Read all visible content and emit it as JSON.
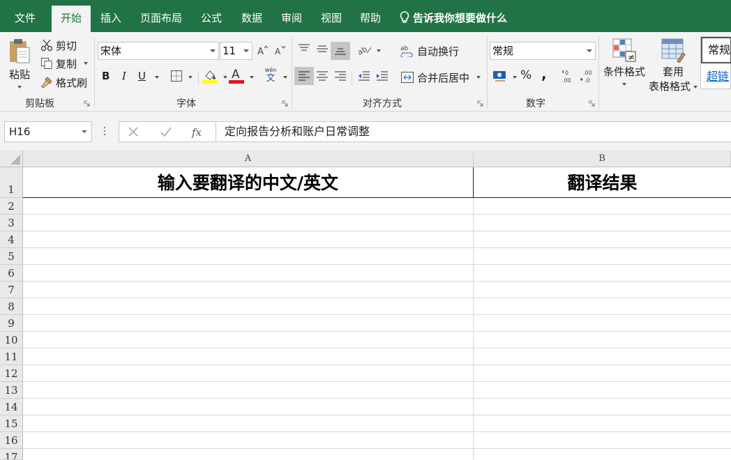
{
  "tabs": [
    {
      "label": "文件",
      "active": false
    },
    {
      "label": "开始",
      "active": true
    },
    {
      "label": "插入",
      "active": false
    },
    {
      "label": "页面布局",
      "active": false
    },
    {
      "label": "公式",
      "active": false
    },
    {
      "label": "数据",
      "active": false
    },
    {
      "label": "审阅",
      "active": false
    },
    {
      "label": "视图",
      "active": false
    },
    {
      "label": "帮助",
      "active": false
    }
  ],
  "tell_me": "告诉我你想要做什么",
  "ribbon": {
    "clipboard": {
      "paste": "粘贴",
      "cut": "剪切",
      "copy": "复制",
      "format_painter": "格式刷",
      "label": "剪贴板"
    },
    "font": {
      "name": "宋体",
      "size": "11",
      "bold": "B",
      "italic": "I",
      "underline": "U",
      "label": "字体",
      "phonetic_top": "wén",
      "phonetic_bottom": "文"
    },
    "alignment": {
      "wrap": "自动换行",
      "merge": "合并后居中",
      "label": "对齐方式"
    },
    "number": {
      "format": "常规",
      "percent": "%",
      "comma": ",",
      "label": "数字"
    },
    "styles": {
      "conditional": "条件格式",
      "table_format_1": "套用",
      "table_format_2": "表格格式",
      "style_normal": "常规",
      "style_link": "超链"
    }
  },
  "formula_bar": {
    "name_box": "H16",
    "formula": "定向报告分析和账户日常调整"
  },
  "columns": [
    "A",
    "B"
  ],
  "rows": [
    "1",
    "2",
    "3",
    "4",
    "5",
    "6",
    "7",
    "8",
    "9",
    "10",
    "11",
    "12",
    "13",
    "14",
    "15",
    "16",
    "17"
  ],
  "cells": {
    "A1": "输入要翻译的中文/英文",
    "B1": "翻译结果"
  },
  "colors": {
    "brand": "#217346",
    "font_highlight": "#ffff00",
    "font_color": "#e81123"
  }
}
